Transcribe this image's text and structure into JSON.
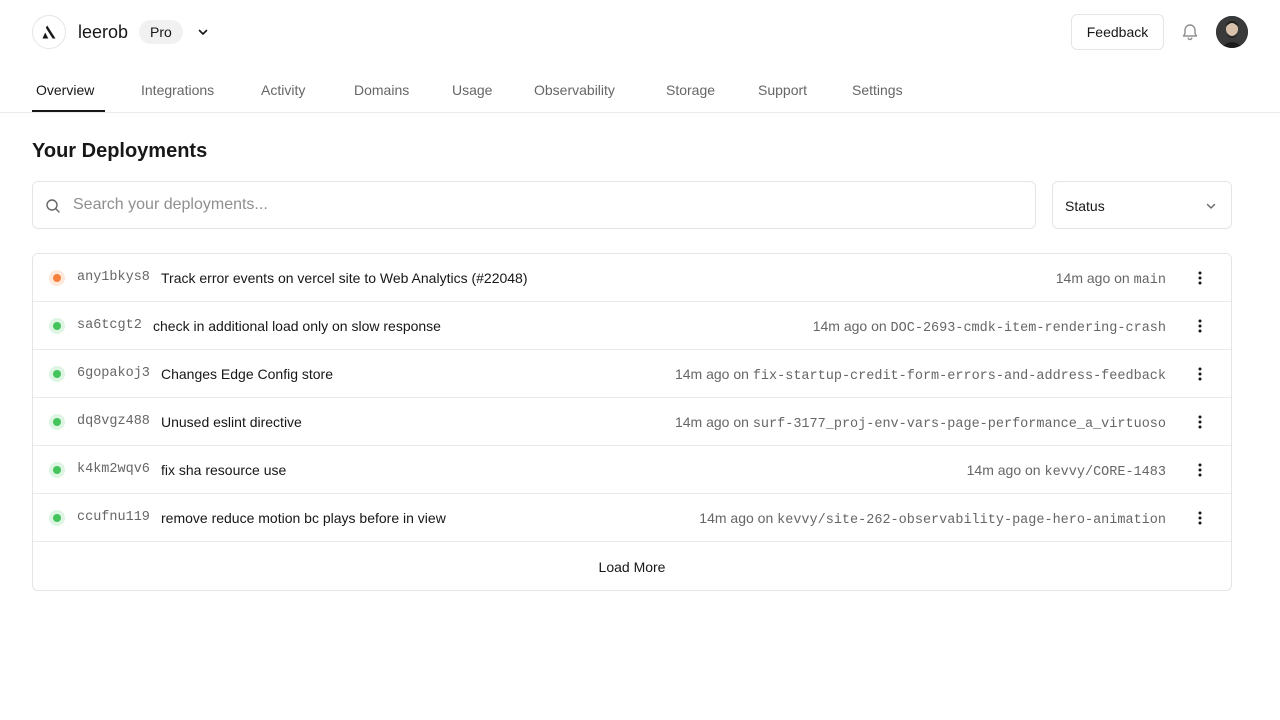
{
  "header": {
    "team_name": "leerob",
    "plan_badge": "Pro",
    "feedback_label": "Feedback"
  },
  "nav": {
    "tabs": [
      {
        "label": "Overview",
        "active": true
      },
      {
        "label": "Integrations"
      },
      {
        "label": "Activity"
      },
      {
        "label": "Domains"
      },
      {
        "label": "Usage"
      },
      {
        "label": "Observability"
      },
      {
        "label": "Storage"
      },
      {
        "label": "Support"
      },
      {
        "label": "Settings"
      }
    ]
  },
  "main": {
    "title": "Your Deployments",
    "search_placeholder": "Search your deployments...",
    "status_filter": "Status",
    "load_more_label": "Load More"
  },
  "colors": {
    "status_building": "#f5803e",
    "status_ready": "#45c45e"
  },
  "icons": {
    "logo": "logo-icon",
    "team_switcher": "chevron-down-icon",
    "notifications": "bell-icon",
    "search": "search-icon",
    "status_dropdown": "chevron-down-icon",
    "row_menu": "more-vertical-icon"
  },
  "deployments": [
    {
      "id": "any1bkys8",
      "message": "Track error events on vercel site to Web Analytics (#22048)",
      "time": "14m ago on",
      "branch": "main",
      "status": "building"
    },
    {
      "id": "sa6tcgt2",
      "message": "check in additional load only on slow response",
      "time": "14m ago on",
      "branch": "DOC-2693-cmdk-item-rendering-crash",
      "status": "ready"
    },
    {
      "id": "6gopakoj3",
      "message": "Changes Edge Config store",
      "time": "14m ago on",
      "branch": "fix-startup-credit-form-errors-and-address-feedback",
      "status": "ready"
    },
    {
      "id": "dq8vgz488",
      "message": "Unused eslint directive",
      "time": "14m ago on",
      "branch": "surf-3177_proj-env-vars-page-performance_a_virtuoso",
      "status": "ready"
    },
    {
      "id": "k4km2wqv6",
      "message": "fix sha resource use",
      "time": "14m ago on",
      "branch": "kevvy/CORE-1483",
      "status": "ready"
    },
    {
      "id": "ccufnu119",
      "message": "remove reduce motion bc plays before in view",
      "time": "14m ago on",
      "branch": "kevvy/site-262-observability-page-hero-animation",
      "status": "ready"
    }
  ]
}
